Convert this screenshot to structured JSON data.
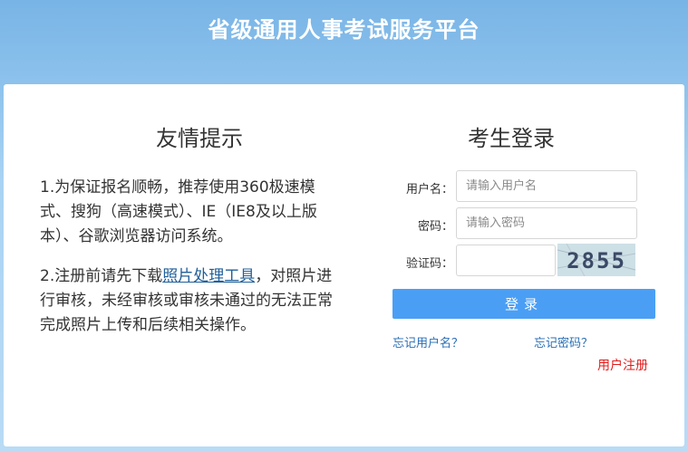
{
  "header": {
    "title": "省级通用人事考试服务平台"
  },
  "tips": {
    "title": "友情提示",
    "para1": "1.为保证报名顺畅，推荐使用360极速模式、搜狗（高速模式）、IE（IE8及以上版本）、谷歌浏览器访问系统。",
    "para2_prefix": "2.注册前请先下载",
    "para2_link": "照片处理工具",
    "para2_suffix": "，对照片进行审核，未经审核或审核未通过的无法正常完成照片上传和后续相关操作。"
  },
  "login": {
    "title": "考生登录",
    "username_label": "用户名：",
    "username_placeholder": "请输入用户名",
    "password_label": "密码：",
    "password_placeholder": "请输入密码",
    "captcha_label": "验证码：",
    "captcha_code": "2855",
    "submit_label": "登录",
    "forgot_username": "忘记用户名？",
    "forgot_password": "忘记密码？",
    "register": "用户注册"
  },
  "colors": {
    "accent": "#4a9ff5",
    "link": "#2a6fb6",
    "register": "#e21b1b"
  }
}
